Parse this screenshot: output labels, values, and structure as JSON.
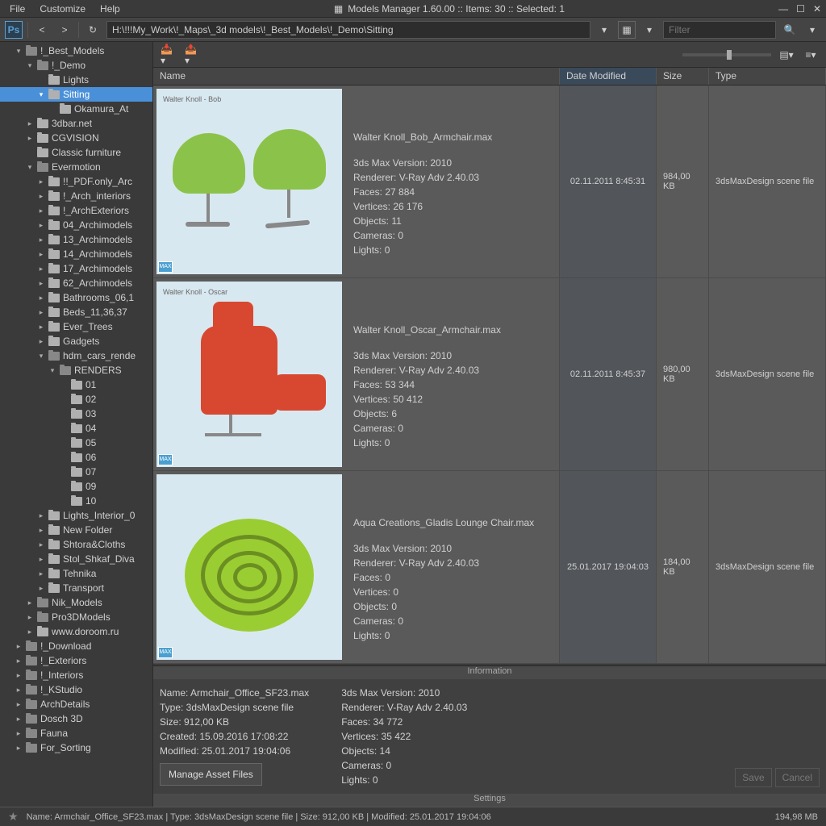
{
  "window": {
    "title": "Models Manager 1.60.00  ::  Items: 30  ::  Selected: 1",
    "menu": [
      "File",
      "Customize",
      "Help"
    ],
    "memory": "194,98 MB"
  },
  "toolbar": {
    "path": "H:\\!!!My_Work\\!_Maps\\_3d models\\!_Best_Models\\!_Demo\\Sitting",
    "filter_placeholder": "Filter"
  },
  "tree": [
    {
      "d": 1,
      "e": "▾",
      "label": "!_Best_Models",
      "dark": true
    },
    {
      "d": 2,
      "e": "▾",
      "label": "!_Demo",
      "dark": true
    },
    {
      "d": 3,
      "e": "",
      "label": "Lights"
    },
    {
      "d": 3,
      "e": "▾",
      "label": "Sitting",
      "sel": true
    },
    {
      "d": 4,
      "e": "",
      "label": "Okamura_At"
    },
    {
      "d": 2,
      "e": "▸",
      "label": "3dbar.net"
    },
    {
      "d": 2,
      "e": "▸",
      "label": "CGVISION"
    },
    {
      "d": 2,
      "e": "",
      "label": "Classic furniture"
    },
    {
      "d": 2,
      "e": "▾",
      "label": "Evermotion",
      "dark": true
    },
    {
      "d": 3,
      "e": "▸",
      "label": "!!_PDF.only_Arc"
    },
    {
      "d": 3,
      "e": "▸",
      "label": "!_Arch_interiors"
    },
    {
      "d": 3,
      "e": "▸",
      "label": "!_ArchExteriors"
    },
    {
      "d": 3,
      "e": "▸",
      "label": "04_Archimodels"
    },
    {
      "d": 3,
      "e": "▸",
      "label": "13_Archimodels"
    },
    {
      "d": 3,
      "e": "▸",
      "label": "14_Archimodels"
    },
    {
      "d": 3,
      "e": "▸",
      "label": "17_Archimodels"
    },
    {
      "d": 3,
      "e": "▸",
      "label": "62_Archimodels"
    },
    {
      "d": 3,
      "e": "▸",
      "label": "Bathrooms_06,1"
    },
    {
      "d": 3,
      "e": "▸",
      "label": "Beds_11,36,37"
    },
    {
      "d": 3,
      "e": "▸",
      "label": "Ever_Trees"
    },
    {
      "d": 3,
      "e": "▸",
      "label": "Gadgets"
    },
    {
      "d": 3,
      "e": "▾",
      "label": "hdm_cars_rende",
      "dark": true
    },
    {
      "d": 4,
      "e": "▾",
      "label": "RENDERS",
      "dark": true
    },
    {
      "d": 5,
      "e": "",
      "label": "01"
    },
    {
      "d": 5,
      "e": "",
      "label": "02"
    },
    {
      "d": 5,
      "e": "",
      "label": "03"
    },
    {
      "d": 5,
      "e": "",
      "label": "04"
    },
    {
      "d": 5,
      "e": "",
      "label": "05"
    },
    {
      "d": 5,
      "e": "",
      "label": "06"
    },
    {
      "d": 5,
      "e": "",
      "label": "07"
    },
    {
      "d": 5,
      "e": "",
      "label": "09"
    },
    {
      "d": 5,
      "e": "",
      "label": "10"
    },
    {
      "d": 3,
      "e": "▸",
      "label": "Lights_Interior_0"
    },
    {
      "d": 3,
      "e": "▸",
      "label": "New Folder"
    },
    {
      "d": 3,
      "e": "▸",
      "label": "Shtora&Cloths"
    },
    {
      "d": 3,
      "e": "▸",
      "label": "Stol_Shkaf_Diva"
    },
    {
      "d": 3,
      "e": "▸",
      "label": "Tehnika"
    },
    {
      "d": 3,
      "e": "▸",
      "label": "Transport"
    },
    {
      "d": 2,
      "e": "▸",
      "label": "Nik_Models",
      "dark": true
    },
    {
      "d": 2,
      "e": "▸",
      "label": "Pro3DModels",
      "dark": true
    },
    {
      "d": 2,
      "e": "▸",
      "label": "www.doroom.ru"
    },
    {
      "d": 1,
      "e": "▸",
      "label": "!_Download",
      "dark": true
    },
    {
      "d": 1,
      "e": "▸",
      "label": "!_Exteriors",
      "dark": true
    },
    {
      "d": 1,
      "e": "▸",
      "label": "!_Interiors",
      "dark": true
    },
    {
      "d": 1,
      "e": "▸",
      "label": "!_KStudio",
      "dark": true
    },
    {
      "d": 1,
      "e": "▸",
      "label": "ArchDetails",
      "dark": true
    },
    {
      "d": 1,
      "e": "▸",
      "label": "Dosch 3D",
      "dark": true
    },
    {
      "d": 1,
      "e": "▸",
      "label": "Fauna",
      "dark": true
    },
    {
      "d": 1,
      "e": "▸",
      "label": "For_Sorting",
      "dark": true
    }
  ],
  "columns": {
    "name": "Name",
    "date": "Date Modified",
    "size": "Size",
    "type": "Type"
  },
  "rows": [
    {
      "thumb_label": "Walter Knoll - Bob",
      "filename": "Walter Knoll_Bob_Armchair.max",
      "meta": [
        "3ds Max Version: 2010",
        "Renderer: V-Ray Adv 2.40.03",
        "Faces: 27 884",
        "Vertices: 26 176",
        "Objects: 11",
        "Cameras: 0",
        "Lights: 0"
      ],
      "date": "02.11.2011 8:45:31",
      "size": "984,00 KB",
      "type": "3dsMaxDesign scene file",
      "kind": "green"
    },
    {
      "thumb_label": "Walter Knoll - Oscar",
      "filename": "Walter Knoll_Oscar_Armchair.max",
      "meta": [
        "3ds Max Version: 2010",
        "Renderer: V-Ray Adv 2.40.03",
        "Faces: 53 344",
        "Vertices: 50 412",
        "Objects: 6",
        "Cameras: 0",
        "Lights: 0"
      ],
      "date": "02.11.2011 8:45:37",
      "size": "980,00 KB",
      "type": "3dsMaxDesign scene file",
      "kind": "red"
    },
    {
      "thumb_label": "",
      "filename": "Aqua Creations_Gladis Lounge Chair.max",
      "meta": [
        "3ds Max Version: 2010",
        "Renderer: V-Ray Adv 2.40.03",
        "Faces: 0",
        "Vertices: 0",
        "Objects: 0",
        "Cameras: 0",
        "Lights: 0"
      ],
      "date": "25.01.2017 19:04:03",
      "size": "184,00 KB",
      "type": "3dsMaxDesign scene file",
      "kind": "pouf"
    }
  ],
  "info": {
    "header": "Information",
    "left": [
      "Name: Armchair_Office_SF23.max",
      "Type: 3dsMaxDesign scene file",
      "Size: 912,00 KB",
      "Created: 15.09.2016 17:08:22",
      "Modified: 25.01.2017 19:04:06"
    ],
    "right": [
      "3ds Max Version: 2010",
      "Renderer: V-Ray Adv 2.40.03",
      "Faces: 34 772",
      "Vertices: 35 422",
      "Objects: 14",
      "Cameras: 0",
      "Lights: 0"
    ],
    "manage_btn": "Manage Asset Files",
    "save": "Save",
    "cancel": "Cancel",
    "settings": "Settings"
  },
  "status": "Name: Armchair_Office_SF23.max | Type: 3dsMaxDesign scene file | Size: 912,00 KB | Modified: 25.01.2017 19:04:06"
}
